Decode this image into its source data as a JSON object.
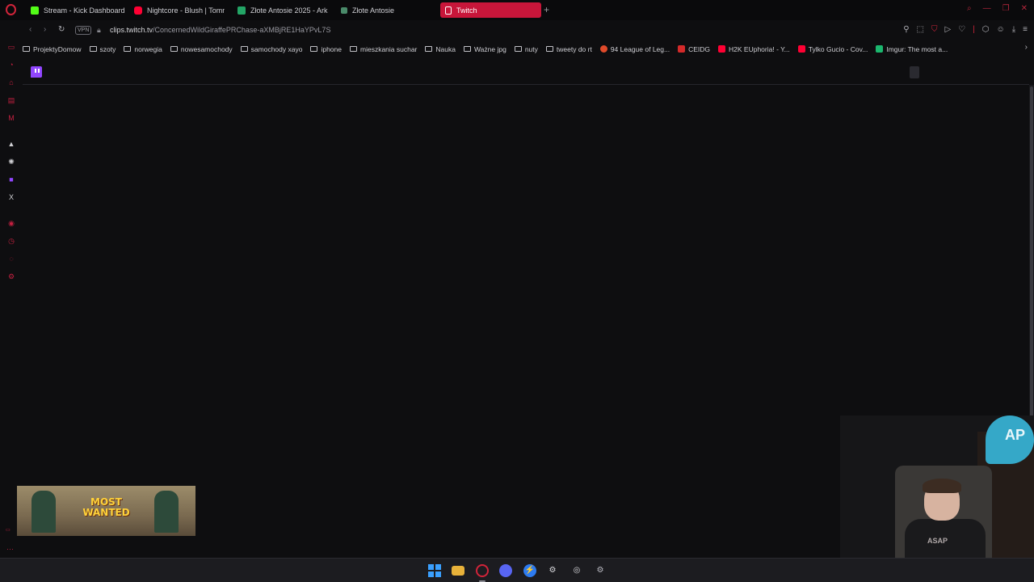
{
  "tabs": [
    {
      "label": "Stream - Kick Dashboard",
      "icon": "kick-icon",
      "color": "#53fc18"
    },
    {
      "label": "Nightcore - Blush | Tomm",
      "icon": "youtube-icon",
      "color": "#ff0033"
    },
    {
      "label": "Złote Antosie 2025 - Ark",
      "icon": "sheets-icon",
      "color": "#23a566"
    },
    {
      "label": "Złote Antosie",
      "icon": "page-icon",
      "color": "#4a8a6a"
    },
    {
      "label": "Twitch",
      "icon": "document-icon",
      "color": "#ffffff",
      "active": true
    }
  ],
  "address": {
    "vpn_label": "VPN",
    "url_host": "clips.twitch.tv",
    "url_path": "/ConcernedWildGiraffePRChase-aXMBjRE1HaYPvL7S"
  },
  "bookmarks": [
    {
      "label": "ProjektyDomow",
      "type": "folder"
    },
    {
      "label": "szoty",
      "type": "folder"
    },
    {
      "label": "norwegia",
      "type": "folder"
    },
    {
      "label": "nowesamochody",
      "type": "folder"
    },
    {
      "label": "samochody xayo",
      "type": "folder"
    },
    {
      "label": "iphone",
      "type": "folder"
    },
    {
      "label": "mieszkania suchar",
      "type": "folder"
    },
    {
      "label": "Nauka",
      "type": "folder"
    },
    {
      "label": "Ważne jpg",
      "type": "folder"
    },
    {
      "label": "nuty",
      "type": "folder"
    },
    {
      "label": "tweety do rt",
      "type": "folder"
    },
    {
      "label": "94 League of Leg...",
      "type": "site",
      "color": "#e04a2a"
    },
    {
      "label": "CEIDG",
      "type": "site",
      "color": "#d42a2a"
    },
    {
      "label": "H2K EUphoria! - Y...",
      "type": "site",
      "color": "#ff0033"
    },
    {
      "label": "Tylko Gucio - Cov...",
      "type": "site",
      "color": "#ff0033"
    },
    {
      "label": "Imgur: The most a...",
      "type": "site",
      "color": "#1bb76e"
    }
  ],
  "promo": {
    "line1": "MOST",
    "line2": "WANTED"
  },
  "webcam": {
    "hoodie_text": "ASAP",
    "balloon_text": "AP"
  },
  "colors": {
    "accent": "#c8163a",
    "twitch": "#9146ff",
    "background": "#0e0e10"
  }
}
